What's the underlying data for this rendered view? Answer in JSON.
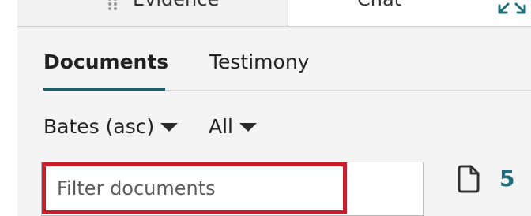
{
  "tabs": {
    "evidence_label": "Evidence",
    "chat_label": "Chat",
    "collapse_icon": "collapse-arrows-icon",
    "drag_icon": "drag-handle-icon"
  },
  "subtabs": {
    "documents_label": "Documents",
    "testimony_label": "Testimony",
    "active": "Documents"
  },
  "controls": {
    "sort_label": "Bates (asc)",
    "filter_label": "All",
    "search_placeholder": "Filter documents",
    "search_value": "",
    "document_icon": "document-icon",
    "document_count": "5"
  },
  "colors": {
    "accent": "#1f5e68",
    "count": "#1f6e7a",
    "focus_border": "#c4202c"
  }
}
